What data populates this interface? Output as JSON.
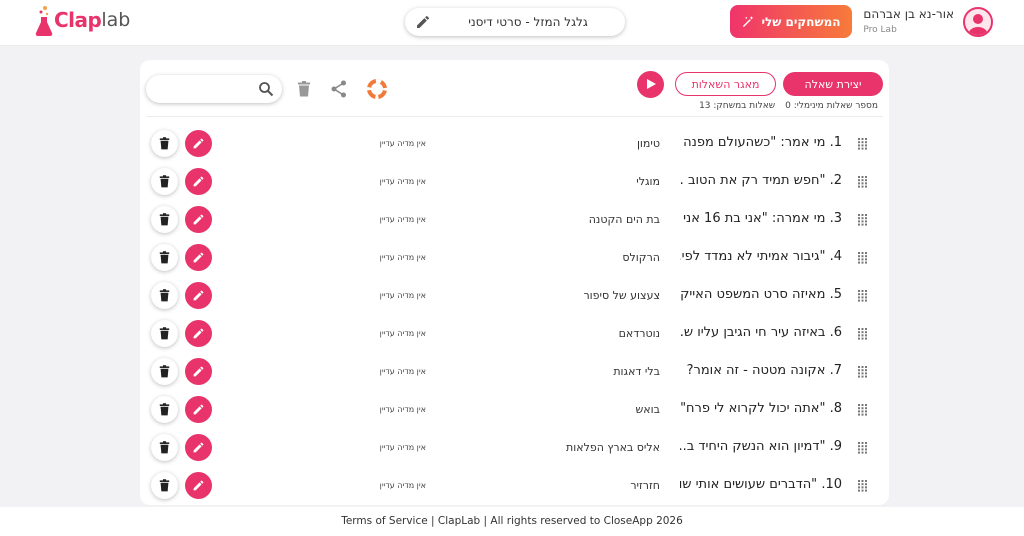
{
  "header": {
    "logo_text_a": "Clap",
    "logo_text_b": "lab",
    "game_title": "גלגל המזל - סרטי דיסני",
    "my_games_label": "המשחקים שלי",
    "user_name": "אור-נא בן אברהם",
    "user_plan": "Pro Lab"
  },
  "toolbar": {
    "create_question": "יצירת שאלה",
    "question_bank": "מאגר השאלות",
    "search_placeholder": "",
    "min_questions_label": "מספר שאלות מינימלי: 0",
    "game_questions_label": "שאלות במשחק: 13"
  },
  "questions": [
    {
      "num": "1.",
      "text": "מי אמר: \"כשהעולם מפנה ...",
      "answer": "טימון",
      "media": "אין מדיה עדיין"
    },
    {
      "num": "2.",
      "text": "\"חפש תמיד רק את הטוב ...",
      "answer": "מוגלי",
      "media": "אין מדיה עדיין"
    },
    {
      "num": "3.",
      "text": "מי אמרה: \"אני בת 16 אני ...",
      "answer": "בת הים הקטנה",
      "media": "אין מדיה עדיין"
    },
    {
      "num": "4.",
      "text": "\"גיבור אמיתי לא נמדד לפי...",
      "answer": "הרקולס",
      "media": "אין מדיה עדיין"
    },
    {
      "num": "5.",
      "text": "מאיזה סרט המשפט האייק...",
      "answer": "צעצוע של סיפור",
      "media": "אין מדיה עדיין"
    },
    {
      "num": "6.",
      "text": "באיזה עיר חי הגיבן עליו ש...",
      "answer": "נוטרדאם",
      "media": "אין מדיה עדיין"
    },
    {
      "num": "7.",
      "text": "אקונה מטטה - זה אומר?",
      "answer": "בלי דאגות",
      "media": "אין מדיה עדיין"
    },
    {
      "num": "8.",
      "text": "\"אתה יכול לקרוא לי פרח\" ...",
      "answer": "בואש",
      "media": "אין מדיה עדיין"
    },
    {
      "num": "9.",
      "text": "\"דמיון הוא הנשק היחיד ב...",
      "answer": "אליס בארץ הפלאות",
      "media": "אין מדיה עדיין"
    },
    {
      "num": "10.",
      "text": "\"הדברים שעושים אותי שו...",
      "answer": "חזרזיר",
      "media": "אין מדיה עדיין"
    }
  ],
  "footer": {
    "text": "Terms of Service | ClapLab | All rights reserved to CloseApp 2026"
  },
  "colors": {
    "accent": "#e8336b",
    "gradient_end": "#f77b3a"
  }
}
